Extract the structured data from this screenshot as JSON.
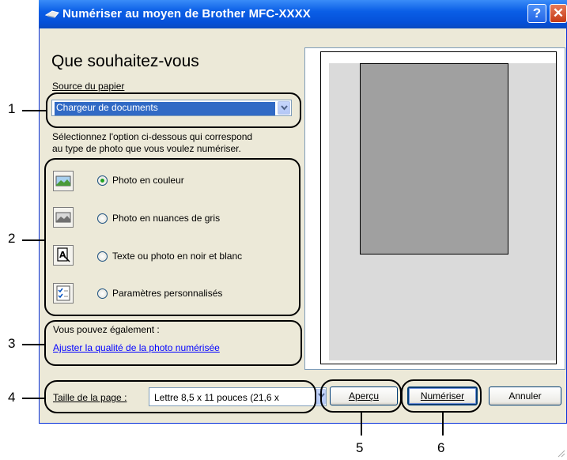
{
  "window": {
    "title": "Numériser au moyen de Brother MFC-XXXX",
    "help_label": "?",
    "close_label": "✕"
  },
  "main": {
    "heading": "Que souhaitez-vous",
    "paper_source": {
      "label": "Source du papier",
      "value": "Chargeur de documents"
    },
    "instruction_line1": "Sélectionnez l'option ci-dessous qui correspond",
    "instruction_line2": "au type de photo que vous voulez numériser.",
    "options": [
      {
        "label": "Photo en couleur",
        "icon": "color-photo-icon",
        "checked": true
      },
      {
        "label": "Photo en nuances de gris",
        "icon": "grayscale-photo-icon",
        "checked": false
      },
      {
        "label": "Texte ou photo en noir et blanc",
        "icon": "bw-text-icon",
        "checked": false
      },
      {
        "label": "Paramètres personnalisés",
        "icon": "custom-settings-icon",
        "checked": false
      }
    ],
    "also_label": "Vous pouvez également :",
    "adjust_link": "Ajuster la qualité de la photo numérisée"
  },
  "footer": {
    "page_size_label": "Taille de la page :",
    "page_size_value": "Lettre 8,5 x 11 pouces (21,6 x",
    "preview_button": "Aperçu",
    "scan_button": "Numériser",
    "cancel_button": "Annuler"
  },
  "callouts": {
    "n1": "1",
    "n2": "2",
    "n3": "3",
    "n4": "4",
    "n5": "5",
    "n6": "6"
  },
  "colors": {
    "titlebar": "#0a5ee6",
    "dialog_bg": "#ece9d8",
    "link": "#0000ff",
    "radio_dot": "#21a121"
  }
}
